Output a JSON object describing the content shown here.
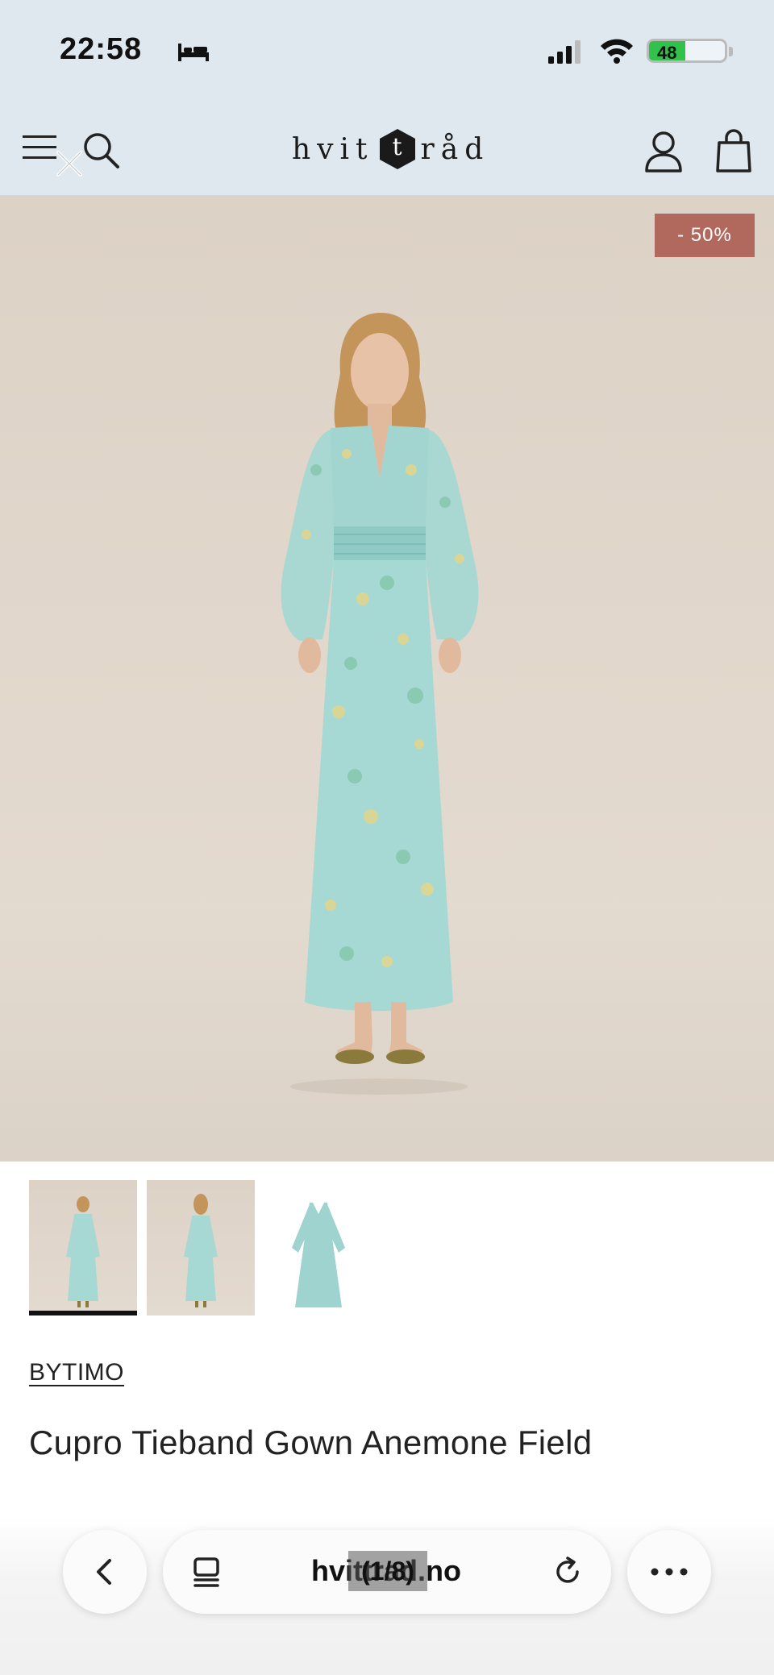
{
  "status_bar": {
    "time": "22:58",
    "battery_level": "48",
    "battery_fraction": 0.48
  },
  "header": {
    "logo_left": "hvit",
    "logo_center": "t",
    "logo_right": "råd",
    "icons": [
      "menu-icon",
      "close-icon",
      "search-icon",
      "account-icon",
      "cart-icon"
    ]
  },
  "product": {
    "discount_badge": "- 50%",
    "brand": "BYTIMO",
    "title": "Cupro Tieband Gown Anemone Field",
    "thumbnails": [
      "front-view",
      "back-view",
      "flat-lay"
    ],
    "active_thumbnail": 0
  },
  "browser": {
    "url": "hvittrad.no",
    "tab_counter": "(1/8)",
    "icons": [
      "back-icon",
      "tabs-icon",
      "reload-icon",
      "more-icon"
    ]
  },
  "colors": {
    "header_bg": "#dfe8ef",
    "badge_bg": "#b2695d",
    "dress": "#9fd3cf",
    "battery_fill": "#30c24a"
  }
}
